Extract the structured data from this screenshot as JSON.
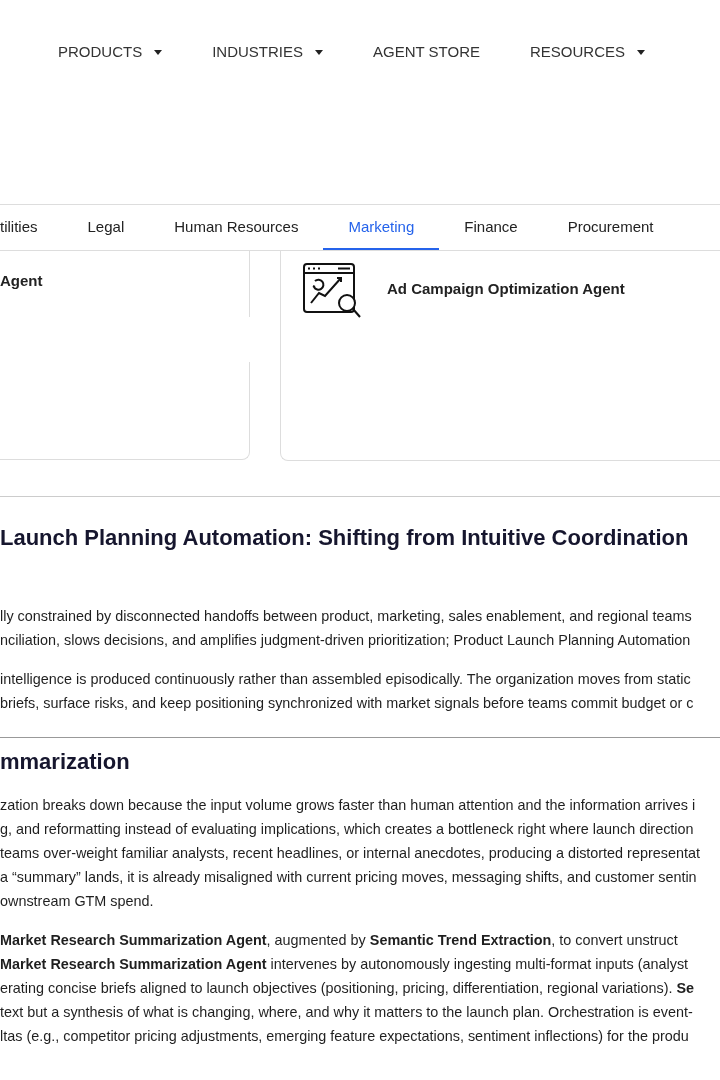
{
  "nav": [
    {
      "label": "PRODUCTS",
      "has_dropdown": true
    },
    {
      "label": "INDUSTRIES",
      "has_dropdown": true
    },
    {
      "label": "AGENT STORE",
      "has_dropdown": false
    },
    {
      "label": "RESOURCES",
      "has_dropdown": true
    }
  ],
  "tabs": [
    {
      "label": "tilities",
      "selected": false
    },
    {
      "label": "Legal",
      "selected": false
    },
    {
      "label": "Human Resources",
      "selected": false
    },
    {
      "label": "Marketing",
      "selected": true
    },
    {
      "label": "Finance",
      "selected": false
    },
    {
      "label": "Procurement",
      "selected": false
    }
  ],
  "cards": [
    {
      "title": "Agent"
    },
    {
      "title": "Ad Campaign Optimization Agent"
    }
  ],
  "article": {
    "title": "Launch Planning Automation: Shifting from Intuitive Coordination",
    "paragraphs": [
      [
        "lly constrained by disconnected handoffs between product, marketing, sales enablement, and regional teams",
        "nciliation, slows decisions, and amplifies judgment-driven prioritization; Product Launch Planning Automation"
      ],
      [
        "intelligence is produced continuously rather than assembled episodically. The organization moves from static",
        "briefs, surface risks, and keep positioning synchronized with market signals before teams commit budget or c"
      ]
    ]
  },
  "section": {
    "title": "mmarization",
    "paragraphs": [
      [
        "zation breaks down because the input volume grows faster than human attention and the information arrives i",
        "g, and reformatting instead of evaluating implications, which creates a bottleneck right where launch direction",
        "teams over-weight familiar analysts, recent headlines, or internal anecdotes, producing a distorted representat",
        "a “summary” lands, it is already misaligned with current pricing moves, messaging shifts, and customer sentin",
        "ownstream GTM spend."
      ],
      [
        "**Market Research Summarization Agent**, augmented by **Semantic Trend Extraction**, to convert unstruct",
        "**Market Research Summarization Agent** intervenes by autonomously ingesting multi-format inputs (analyst",
        "erating concise briefs aligned to launch objectives (positioning, pricing, differentiation, regional variations). **Se**",
        "text but a synthesis of what is changing, where, and why it matters to the launch plan. Orchestration is event-",
        "ltas (e.g., competitor pricing adjustments, emerging feature expectations, sentiment inflections) for the produ"
      ]
    ]
  }
}
